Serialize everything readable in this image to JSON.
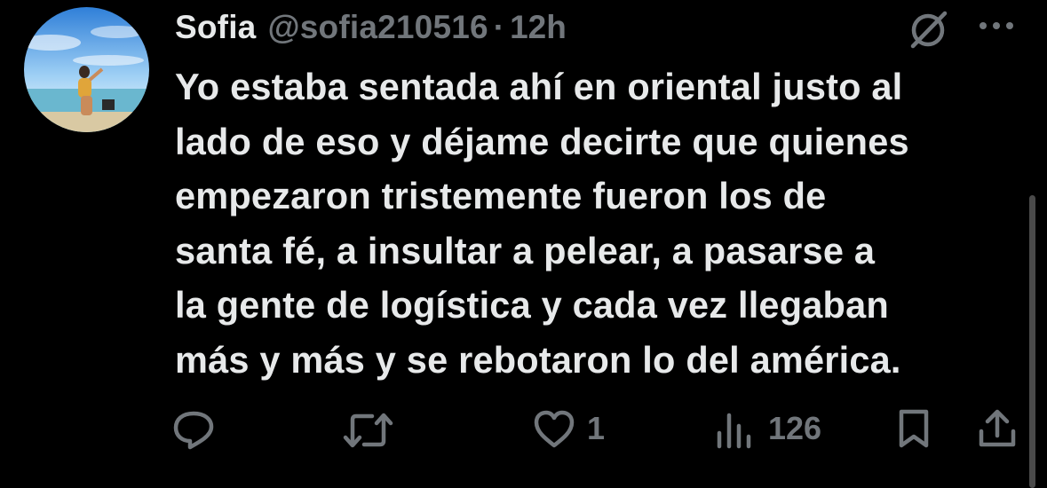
{
  "tweet": {
    "author": {
      "display_name": "Sofia",
      "handle": "@sofia210516",
      "separator": "·",
      "time_ago": "12h"
    },
    "text": "Yo estaba sentada ahí en oriental justo al\nlado de eso y déjame decirte que quienes\nempezaron tristemente fueron los de\nsanta fé, a insultar a pelear, a pasarse a\nla gente de logística y cada vez llegaban\nmás y más y se rebotaron lo del américa.",
    "actions": {
      "reply": {
        "icon": "reply-icon",
        "count": ""
      },
      "retweet": {
        "icon": "retweet-icon",
        "count": ""
      },
      "like": {
        "icon": "heart-icon",
        "count": "1"
      },
      "views": {
        "icon": "views-icon",
        "count": "126"
      },
      "bookmark": {
        "icon": "bookmark-icon"
      },
      "share": {
        "icon": "share-icon"
      }
    }
  },
  "colors": {
    "background": "#000000",
    "primary_text": "#e7e9ea",
    "secondary_text": "#71767b"
  }
}
